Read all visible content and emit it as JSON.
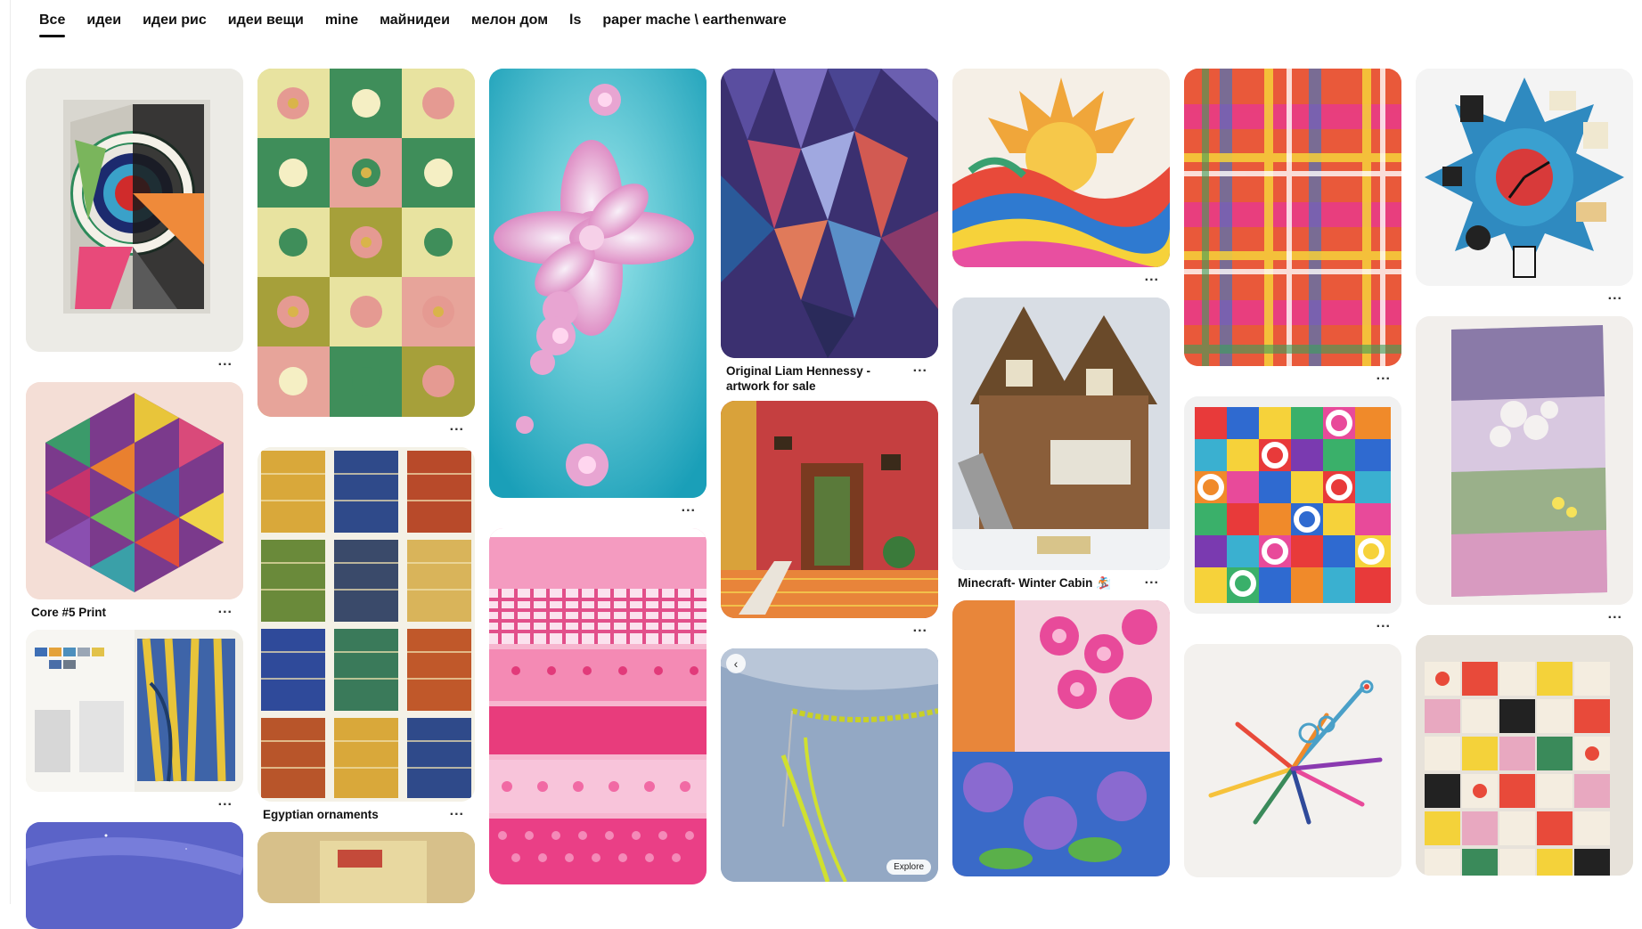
{
  "tabs": [
    {
      "label": "Все",
      "active": true
    },
    {
      "label": "идеи"
    },
    {
      "label": "идеи рис"
    },
    {
      "label": "идеи вещи"
    },
    {
      "label": "mine"
    },
    {
      "label": "майнидеи"
    },
    {
      "label": "мелон дом"
    },
    {
      "label": "ls"
    },
    {
      "label": "paper mache \\ earthenware"
    }
  ],
  "pins": {
    "p1": {
      "title": ""
    },
    "p2": {
      "title": "Core #5 Print"
    },
    "p3": {
      "title": ""
    },
    "p5": {
      "title": ""
    },
    "p6": {
      "title": "Egyptian ornaments"
    },
    "p8": {
      "title": ""
    },
    "p10": {
      "title": "Original Liam Hennessy - artwork for sale"
    },
    "p11": {
      "title": ""
    },
    "p12": {
      "title": "",
      "explore_label": "Explore"
    },
    "p13": {
      "title": ""
    },
    "p14": {
      "title": "Minecraft- Winter Cabin 🏂"
    },
    "p16": {
      "title": ""
    },
    "p17": {
      "title": ""
    },
    "p19": {
      "title": ""
    },
    "p20": {
      "title": ""
    }
  },
  "more_label": "...",
  "colors": {
    "accent": "#111111",
    "background": "#ffffff"
  }
}
